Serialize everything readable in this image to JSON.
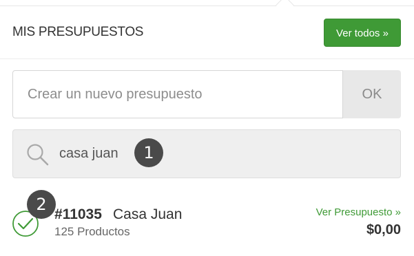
{
  "header": {
    "title": "MIS PRESUPUESTOS",
    "see_all_label": "Ver todos »"
  },
  "create": {
    "placeholder": "Crear un nuevo presupuesto",
    "ok_label": "OK"
  },
  "search": {
    "value": "casa juan",
    "icon": "search-icon"
  },
  "annotations": {
    "step_1": "1",
    "step_2": "2"
  },
  "results": [
    {
      "number": "#11035",
      "name": "Casa Juan",
      "count_label": "125 Productos",
      "link_label": "Ver Presupuesto »",
      "price": "$0,00",
      "selected_icon": "check-circle-icon"
    }
  ],
  "colors": {
    "accent": "#3f9a36",
    "badge": "#4a4a4a",
    "search_bg": "#efefef"
  }
}
